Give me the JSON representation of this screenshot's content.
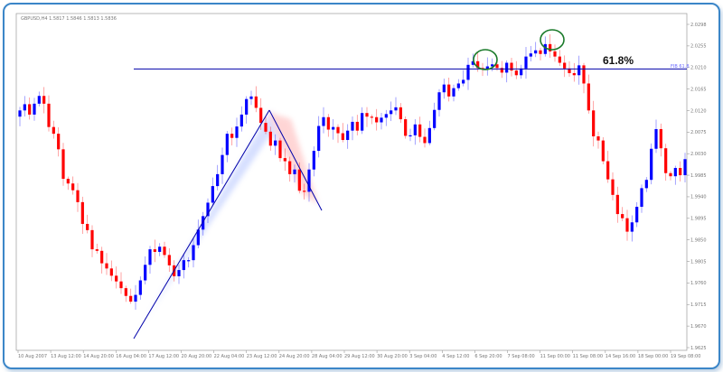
{
  "chart_data": {
    "type": "candlestick",
    "symbol_header": "GBPUSD,H4  1.5817 1.5846 1.5813 1.5836",
    "fib_label": "61.8%",
    "fib_axis_tag": "FIB 61.8",
    "ylim": [
      1.9655,
      2.0305
    ],
    "y_ticks": [
      "2.0298",
      "2.0255",
      "2.0210",
      "2.0165",
      "2.0120",
      "2.0075",
      "2.0030",
      "1.9985",
      "1.9940",
      "1.9895",
      "1.9850",
      "1.9805",
      "1.9760",
      "1.9715",
      "1.9670",
      "1.9625"
    ],
    "x_ticks": [
      "10 Aug 2007",
      "13 Aug 12:00",
      "14 Aug 20:00",
      "16 Aug 04:00",
      "17 Aug 12:00",
      "20 Aug 20:00",
      "22 Aug 04:00",
      "23 Aug 12:00",
      "24 Aug 20:00",
      "28 Aug 04:00",
      "29 Aug 12:00",
      "30 Aug 20:00",
      "3 Sep 04:00",
      "4 Sep 12:00",
      "6 Sep 20:00",
      "7 Sep 08:00",
      "11 Sep 00:00",
      "11 Sep 08:00",
      "14 Sep 16:00",
      "18 Sep 00:00",
      "19 Sep 08:00"
    ],
    "fib_level": 2.0198,
    "bull_color": "#0000ff",
    "bear_color": "#ff0000",
    "line_color": "#0000aa",
    "circle_color": "#1a7a2a",
    "frame_color": "#3b86c8",
    "closes": [
      2.0118,
      2.013,
      2.011,
      2.0131,
      2.0146,
      2.0131,
      2.0086,
      2.0073,
      2.0043,
      1.9986,
      1.9977,
      1.9964,
      1.9941,
      1.9899,
      1.9887,
      1.985,
      1.9847,
      1.9823,
      1.9813,
      1.9799,
      1.9788,
      1.9775,
      1.976,
      1.9749,
      1.9762,
      1.979,
      1.982,
      1.985,
      1.9845,
      1.9855,
      1.9839,
      1.9819,
      1.9798,
      1.981,
      1.9829,
      1.9829,
      1.9858,
      1.9888,
      1.9914,
      1.994,
      1.9972,
      1.9995,
      2.0032,
      2.0073,
      2.0065,
      2.0087,
      2.011,
      2.014,
      2.0145,
      2.0123,
      2.0094,
      2.0077,
      2.005,
      2.006,
      2.0026,
      2.002,
      1.9995,
      2.0004,
      1.9963,
      1.9961,
      2.0004,
      2.004,
      2.0088,
      2.0105,
      2.0081,
      2.0086,
      2.0074,
      2.0061,
      2.0079,
      2.0096,
      2.0079,
      2.0113,
      2.0106,
      2.0105,
      2.0095,
      2.0104,
      2.0111,
      2.0118,
      2.0124,
      2.0101,
      2.0069,
      2.007,
      2.0091,
      2.0067,
      2.0055,
      2.0084,
      2.0119,
      2.0153,
      2.0168,
      2.0145,
      2.0161,
      2.017,
      2.0177,
      2.0206,
      2.0213,
      2.02,
      2.0197,
      2.0203,
      2.0207,
      2.02,
      2.0191,
      2.021,
      2.0195,
      2.0186,
      2.0199,
      2.0222,
      2.0228,
      2.0234,
      2.0227,
      2.0246,
      2.0232,
      2.0222,
      2.021,
      2.0199,
      2.019,
      2.0186,
      2.0205,
      2.017,
      2.0118,
      2.0068,
      2.006,
      2.002,
      1.9985,
      1.9955,
      1.9918,
      1.991,
      1.9884,
      1.9902,
      1.9932,
      1.9968,
      1.9984,
      2.0044,
      2.0082,
      2.0045,
      1.9997,
      1.9991,
      2.0007,
      1.9993,
      2.0024
    ]
  }
}
